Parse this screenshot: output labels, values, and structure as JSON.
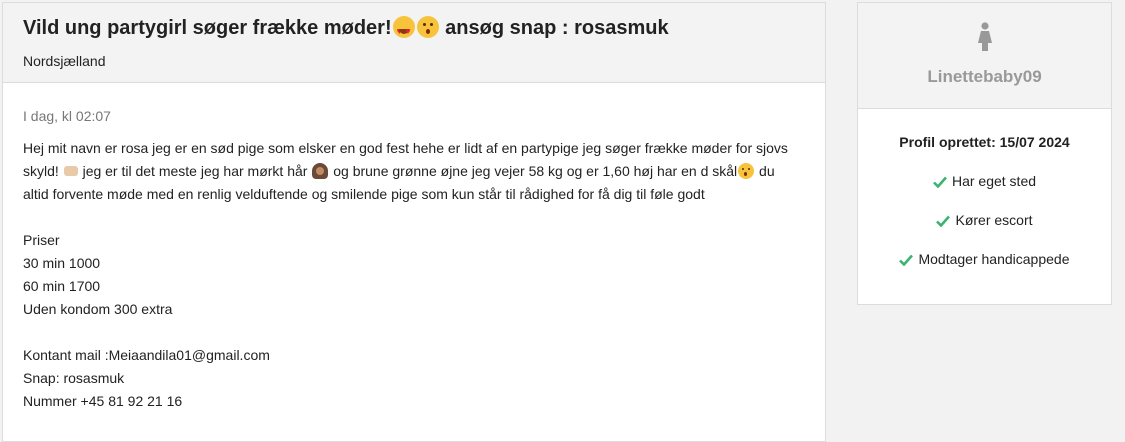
{
  "ad": {
    "title_part1": "Vild ung partygirl søger frække møder!",
    "title_part2": "ansøg snap : rosasmuk",
    "location": "Nordsjælland",
    "date": "I dag, kl 02:07",
    "description_line1": "Hej mit navn er rosa jeg er en sød pige som elsker en god fest hehe er lidt af en partypige jeg søger frække møder for sjovs",
    "description_line2a": "skyld!",
    "description_line2b": "jeg er til det meste jeg har mørkt hår",
    "description_line2c": "og brune grønne øjne jeg vejer 58 kg og er 1,60 høj har en d skål",
    "description_line2d": "du",
    "description_line3": "altid forvente møde med en renlig velduftende og smilende pige som kun står til rådighed for få dig til føle godt",
    "prices": [
      "Priser",
      "30 min 1000",
      "60 min 1700",
      "Uden kondom 300 extra"
    ],
    "contact": [
      "Kontant mail :Meiaandila01@gmail.com",
      "Snap: rosasmuk",
      "Nummer +45 81 92 21 16"
    ]
  },
  "profile": {
    "icon": "female-person-icon",
    "username": "Linettebaby09",
    "created": "Profil oprettet: 15/07 2024",
    "features": [
      "Har eget sted",
      "Kører escort",
      "Modtager handicappede"
    ],
    "check_color": "#3cb371"
  },
  "emojis": [
    "heart-eyes-emoji",
    "kissing-face-emoji",
    "palms-together-emoji",
    "woman-emoji",
    "kissing-face-emoji"
  ]
}
